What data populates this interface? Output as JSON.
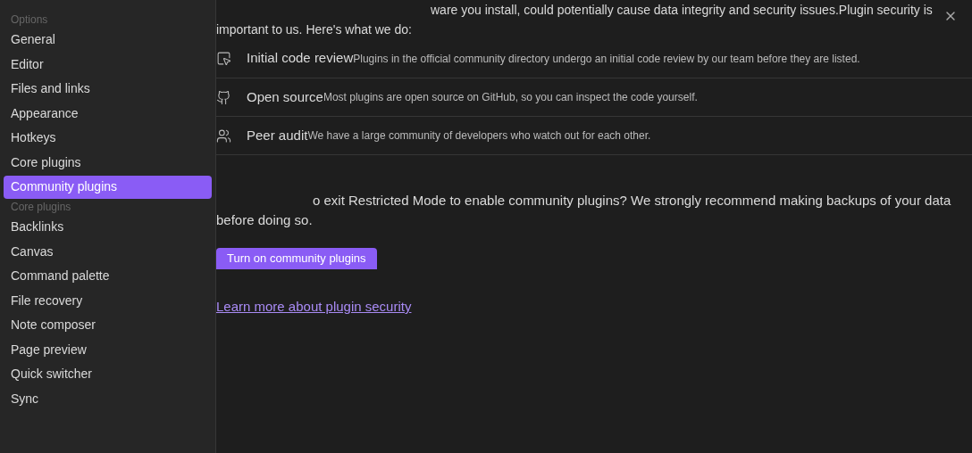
{
  "sidebar": {
    "sections": [
      {
        "heading": "Options",
        "items": [
          {
            "label": "General",
            "selected": false
          },
          {
            "label": "Editor",
            "selected": false
          },
          {
            "label": "Files and links",
            "selected": false
          },
          {
            "label": "Appearance",
            "selected": false
          },
          {
            "label": "Hotkeys",
            "selected": false
          },
          {
            "label": "Core plugins",
            "selected": false
          },
          {
            "label": "Community plugins",
            "selected": true
          }
        ]
      },
      {
        "heading": "Core plugins",
        "items": [
          {
            "label": "Backlinks",
            "selected": false
          },
          {
            "label": "Canvas",
            "selected": false
          },
          {
            "label": "Command palette",
            "selected": false
          },
          {
            "label": "File recovery",
            "selected": false
          },
          {
            "label": "Note composer",
            "selected": false
          },
          {
            "label": "Page preview",
            "selected": false
          },
          {
            "label": "Quick switcher",
            "selected": false
          },
          {
            "label": "Sync",
            "selected": false
          }
        ]
      }
    ]
  },
  "main": {
    "intro": "ware you install, could potentially cause data integrity and security issues.Plugin security is important to us. Here's what we do:",
    "features": [
      {
        "kind": "review",
        "title": "Initial code review",
        "description": "Plugins in the official community directory undergo an initial code review by our team before they are listed."
      },
      {
        "kind": "github",
        "title": "Open source",
        "description": "Most plugins are open source on GitHub, so you can inspect the code yourself."
      },
      {
        "kind": "users",
        "title": "Peer audit",
        "description": "We have a large community of developers who watch out for each other."
      }
    ],
    "question": "o exit Restricted Mode to enable community plugins? We strongly recommend making backups of your data before doing so.",
    "button": "Turn on community plugins",
    "link": "Learn more about plugin security"
  }
}
